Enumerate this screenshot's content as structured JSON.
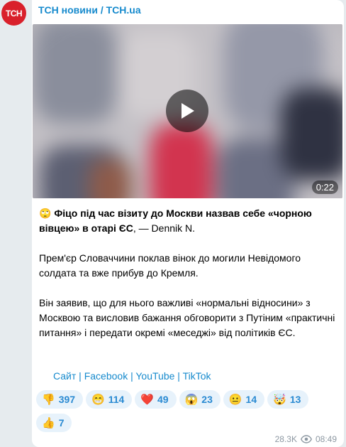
{
  "channel": {
    "avatar_text": "ТСН",
    "name": "ТСН новини / TCH.ua"
  },
  "video": {
    "duration": "0:22"
  },
  "message": {
    "emoji": "🙄",
    "headline_bold": "Фіцо під час візиту до Москви назвав себе «чорною вівцею» в отарі ЄС",
    "headline_rest": ", — Dennik N.",
    "paragraph2": "Прем'єр Словаччини поклав вінок до могили Невідомого солдата та вже прибув до Кремля.",
    "paragraph3": "Він заявив, що для нього важливі «нормальні відносини» з Москвою та висловив бажання обговорити з Путіним «практичні питання» і передати окремі «меседжі» від політиків ЄС."
  },
  "links": {
    "site": "Сайт",
    "facebook": "Facebook",
    "youtube": "YouTube",
    "tiktok": "TikTok",
    "separator": " | "
  },
  "reactions": [
    {
      "emoji": "👎",
      "count": "397"
    },
    {
      "emoji": "😁",
      "count": "114"
    },
    {
      "emoji": "❤️",
      "count": "49"
    },
    {
      "emoji": "😱",
      "count": "23"
    },
    {
      "emoji": "😐",
      "count": "14"
    },
    {
      "emoji": "🤯",
      "count": "13"
    },
    {
      "emoji": "👍",
      "count": "7"
    }
  ],
  "meta": {
    "views": "28.3K",
    "time": "08:49"
  }
}
